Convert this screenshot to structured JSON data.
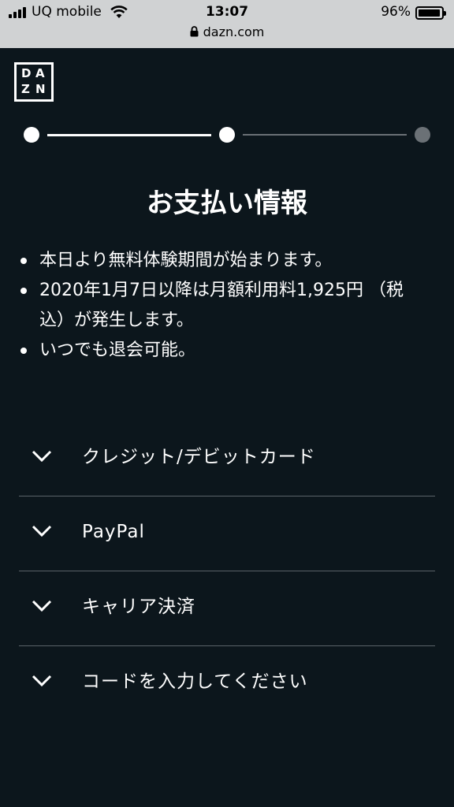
{
  "status_bar": {
    "carrier": "UQ mobile",
    "time": "13:07",
    "battery_percent": "96%",
    "battery_level": 0.96
  },
  "browser": {
    "url": "dazn.com"
  },
  "logo": {
    "letters": [
      "D",
      "A",
      "Z",
      "N"
    ]
  },
  "stepper": {
    "total_steps": 3,
    "current_step": 2
  },
  "page": {
    "title": "お支払い情報",
    "bullets": [
      "本日より無料体験期間が始まります。",
      "2020年1月7日以降は月額利用料1,925円 （税込）が発生します。",
      "いつでも退会可能。"
    ]
  },
  "payment_methods": [
    {
      "label": "クレジット/デビットカード",
      "icon": "chevron-down-icon"
    },
    {
      "label": "PayPal",
      "icon": "chevron-down-icon"
    },
    {
      "label": "キャリア決済",
      "icon": "chevron-down-icon"
    },
    {
      "label": "コードを入力してください",
      "icon": "chevron-down-icon"
    }
  ],
  "colors": {
    "background": "#0c161c",
    "browser_bar": "#d0d2d3",
    "text": "#ffffff",
    "step_done": "#ffffff",
    "step_pending": "#6b7176",
    "divider": "#5a6268"
  }
}
